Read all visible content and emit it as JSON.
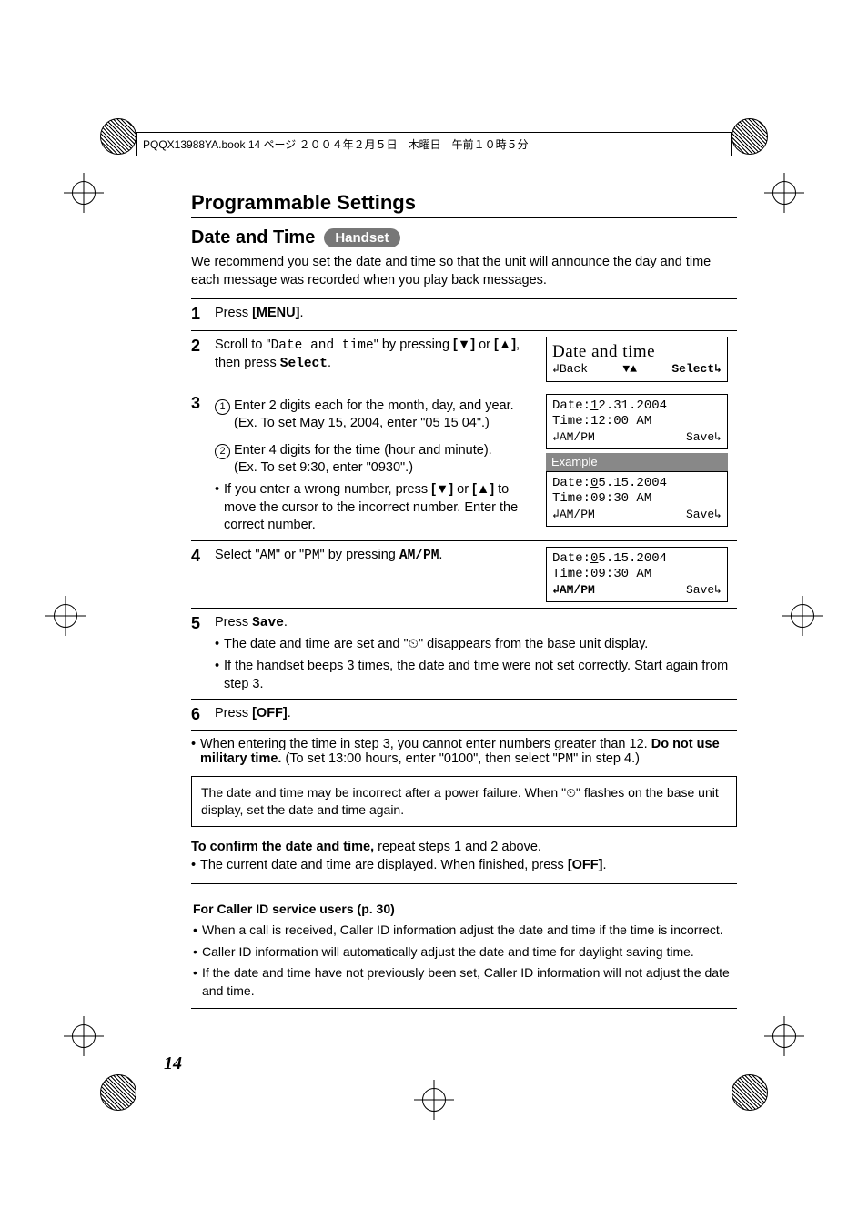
{
  "header_info": "PQQX13988YA.book  14 ページ  ２００４年２月５日　木曜日　午前１０時５分",
  "section_title": "Programmable Settings",
  "subtitle": "Date and Time",
  "badge": "Handset",
  "intro": "We recommend you set the date and time so that the unit will announce the day and time each message was recorded when you play back messages.",
  "steps": {
    "s1": {
      "num": "1",
      "text_pre": "Press ",
      "bold": "[MENU]",
      "text_post": "."
    },
    "s2": {
      "num": "2",
      "seg1": "Scroll to \"",
      "mono": "Date and time",
      "seg2": "\" by pressing ",
      "bold1": "[▼]",
      "seg3": " or ",
      "bold2": "[▲]",
      "seg4": ", then press ",
      "mono2": "Select",
      "seg5": ".",
      "lcd_title": "Date and time",
      "lcd_soft_left": "Back",
      "lcd_soft_mid": "▼▲",
      "lcd_soft_right": "Select"
    },
    "s3": {
      "num": "3",
      "c1": "1",
      "c1_text": "Enter 2 digits each for the month, day, and year. (Ex. To set May 15, 2004, enter \"05 15 04\".)",
      "c2": "2",
      "c2_text_a": "Enter 4 digits for the time (hour and minute).",
      "c2_text_b": "(Ex. To set 9:30, enter \"0930\".)",
      "bullet_pre": "If you enter a wrong number, press ",
      "bullet_b1": "[▼]",
      "bullet_mid": " or ",
      "bullet_b2": "[▲]",
      "bullet_post": " to move the cursor to the incorrect number. Enter the correct number.",
      "lcd1_l1_pre": "Date:",
      "lcd1_l1_cur": "1",
      "lcd1_l1_post": "2.31.2004",
      "lcd1_l2": "Time:12:00 AM",
      "lcd1_soft_left": "AM/PM",
      "lcd1_soft_right": "Save",
      "example_label": "Example",
      "lcd2_l1_pre": "Date:",
      "lcd2_l1_cur": "0",
      "lcd2_l1_post": "5.15.2004",
      "lcd2_l2": "Time:09:30 AM",
      "lcd2_soft_left": "AM/PM",
      "lcd2_soft_right": "Save"
    },
    "s4": {
      "num": "4",
      "seg1": "Select \"",
      "mono1": "AM",
      "seg2": "\" or \"",
      "mono2": "PM",
      "seg3": "\" by pressing ",
      "mono3": "AM/PM",
      "seg4": ".",
      "lcd_l1_pre": "Date:",
      "lcd_l1_cur": "0",
      "lcd_l1_post": "5.15.2004",
      "lcd_l2": "Time:09:30 AM",
      "lcd_soft_left": "AM/PM",
      "lcd_soft_right": "Save"
    },
    "s5": {
      "num": "5",
      "seg1": "Press ",
      "mono": "Save",
      "seg2": ".",
      "b1_pre": "The date and time are set and \"",
      "b1_icon": "⏲",
      "b1_post": "\" disappears from the base unit display.",
      "b2": "If the handset beeps 3 times, the date and time were not set correctly. Start again from step 3."
    },
    "s6": {
      "num": "6",
      "seg1": "Press ",
      "bold": "[OFF]",
      "seg2": "."
    }
  },
  "after_steps": {
    "bullet_pre": "When entering the time in step 3, you cannot enter numbers greater than 12. ",
    "bullet_bold": "Do not use military time.",
    "bullet_seg2": " (To set 13:00 hours, enter \"0100\", then select \"",
    "bullet_mono": "PM",
    "bullet_seg3": "\" in step 4.)"
  },
  "note_box": {
    "pre": "The date and time may be incorrect after a power failure. When \"",
    "icon": "⏲",
    "post": "\" flashes on the base unit display, set the date and time again."
  },
  "confirm": {
    "lead_bold": "To confirm the date and time,",
    "lead_rest": " repeat steps 1 and 2 above.",
    "bullet_pre": "The current date and time are displayed. When finished, press ",
    "bullet_bold": "[OFF]",
    "bullet_post": "."
  },
  "caller": {
    "title": "For Caller ID service users (p. 30)",
    "b1": "When a call is received, Caller ID information adjust the date and time if the time is incorrect.",
    "b2": "Caller ID information will automatically adjust the date and time for daylight saving time.",
    "b3": "If the date and time have not previously been set, Caller ID information will not adjust the date and time."
  },
  "page_number": "14"
}
